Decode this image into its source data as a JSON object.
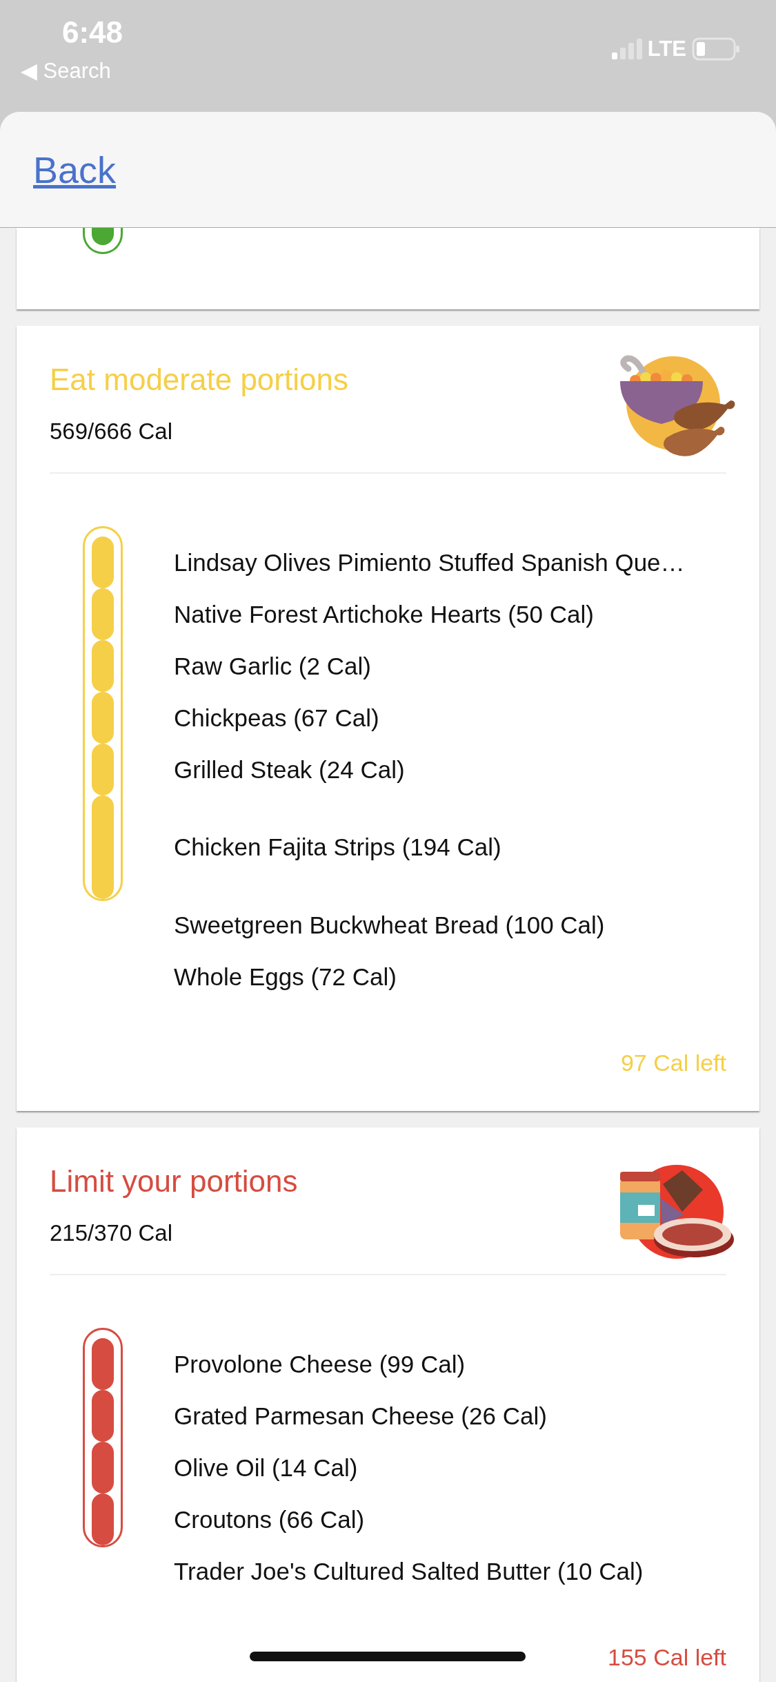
{
  "status_bar": {
    "time": "6:48",
    "back_app": "◀ Search",
    "network": "LTE"
  },
  "nav": {
    "back": "Back"
  },
  "previous_card": {
    "color": "#4aa833"
  },
  "cards": [
    {
      "title": "Eat moderate portions",
      "total": "569/666 Cal",
      "color": "#f5cf48",
      "kind": "bowl",
      "left": "97 Cal left",
      "items": [
        {
          "name": "Lindsay Olives Pimiento Stuffed Spanish Que…",
          "on_meter": true,
          "kind": "normal"
        },
        {
          "name": "Native Forest Artichoke Hearts (50 Cal)",
          "on_meter": true,
          "kind": "normal"
        },
        {
          "name": "Raw Garlic (2 Cal)",
          "on_meter": true,
          "kind": "normal"
        },
        {
          "name": "Chickpeas (67 Cal)",
          "on_meter": true,
          "kind": "normal"
        },
        {
          "name": "Grilled Steak (24 Cal)",
          "on_meter": true,
          "kind": "normal"
        },
        {
          "name": "Chicken Fajita Strips (194 Cal)",
          "on_meter": true,
          "kind": "large"
        },
        {
          "name": "Sweetgreen Buckwheat Bread (100 Cal)",
          "on_meter": false,
          "kind": "normal"
        },
        {
          "name": "Whole Eggs (72 Cal)",
          "on_meter": false,
          "kind": "normal"
        }
      ]
    },
    {
      "title": "Limit your portions",
      "total": "215/370 Cal",
      "color": "#d64c41",
      "kind": "steak",
      "left": "155 Cal left",
      "items": [
        {
          "name": "Provolone Cheese (99 Cal)",
          "on_meter": true,
          "kind": "normal"
        },
        {
          "name": "Grated Parmesan Cheese (26 Cal)",
          "on_meter": true,
          "kind": "normal"
        },
        {
          "name": "Olive Oil (14 Cal)",
          "on_meter": true,
          "kind": "normal"
        },
        {
          "name": "Croutons (66 Cal)",
          "on_meter": true,
          "kind": "normal"
        },
        {
          "name": "Trader Joe's Cultured Salted Butter (10 Cal)",
          "on_meter": false,
          "kind": "normal"
        }
      ]
    }
  ]
}
